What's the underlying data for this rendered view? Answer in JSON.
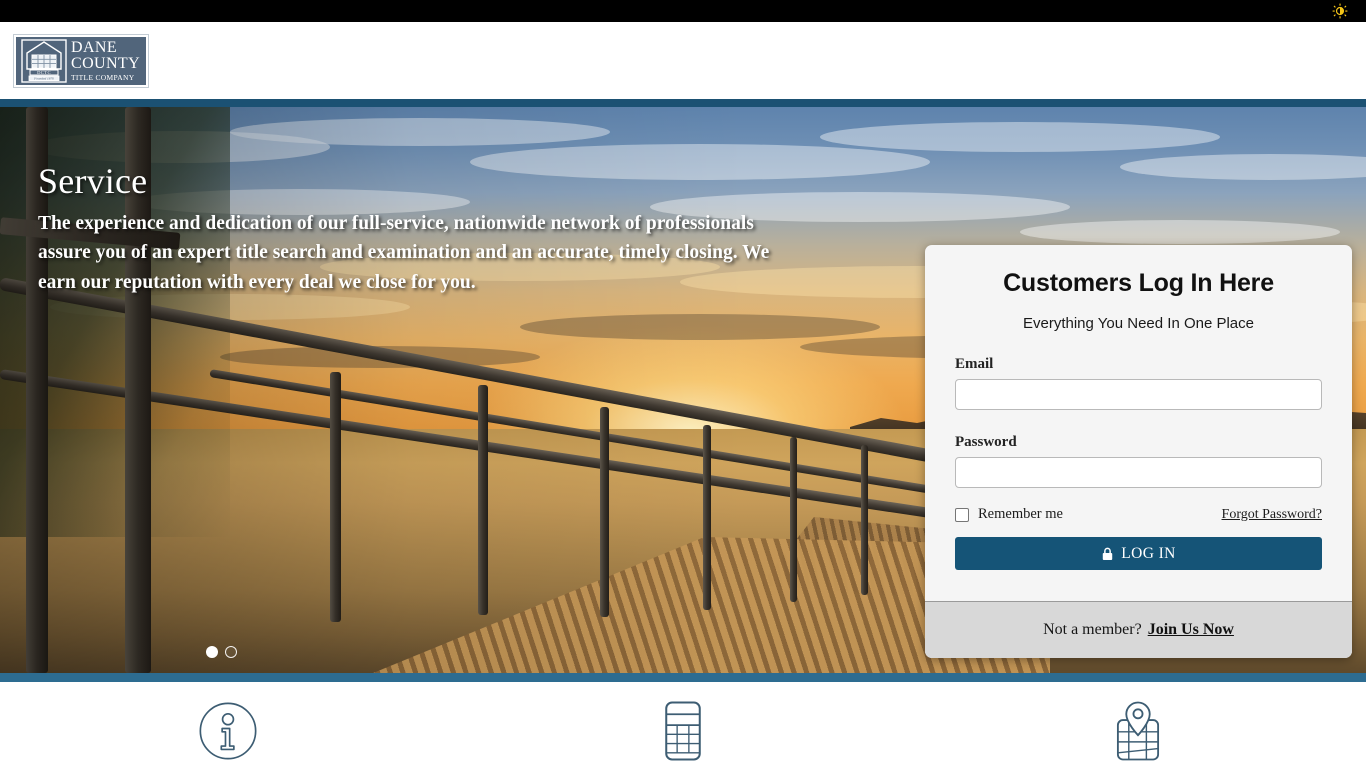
{
  "topbar": {
    "brightness_icon": "brightness-sun-icon",
    "icon_color": "#f5c518",
    "background": "#000000"
  },
  "header": {
    "logo": {
      "icon": "window-building-icon",
      "line1": "DANE",
      "line2": "COUNTY",
      "line3": "TITLE COMPANY",
      "founded_ribbon": "Founded 1876",
      "monogram": "DCTC",
      "background": "#51657b"
    },
    "rule_color": "#1b5173"
  },
  "hero": {
    "slide_title": "Service",
    "slide_text": "The experience and dedication of our full-service, nationwide network of professionals assure you of an expert title search and examination and an accurate, timely closing. We earn our reputation with every deal we close for you.",
    "carousel": {
      "dots": [
        {
          "name": "slide-1",
          "active": true
        },
        {
          "name": "slide-2",
          "active": false
        }
      ]
    },
    "bottom_bar_color": "#2d6c91"
  },
  "login": {
    "title": "Customers Log In Here",
    "subtitle": "Everything You Need In One Place",
    "email": {
      "label": "Email",
      "value": "",
      "placeholder": ""
    },
    "password": {
      "label": "Password",
      "value": "",
      "placeholder": ""
    },
    "remember_label": "Remember me",
    "remember_checked": false,
    "forgot_label": "Forgot Password?",
    "submit_label": "LOG IN",
    "submit_icon": "lock-icon",
    "submit_color": "#155477",
    "footer_prompt": "Not a member?",
    "footer_link": "Join Us Now",
    "card_background": "#f5f5f5",
    "footer_background": "#d8d8d8"
  },
  "features": [
    {
      "icon": "info-circle-icon",
      "label": ""
    },
    {
      "icon": "calculator-icon",
      "label": ""
    },
    {
      "icon": "map-pin-icon",
      "label": ""
    }
  ]
}
